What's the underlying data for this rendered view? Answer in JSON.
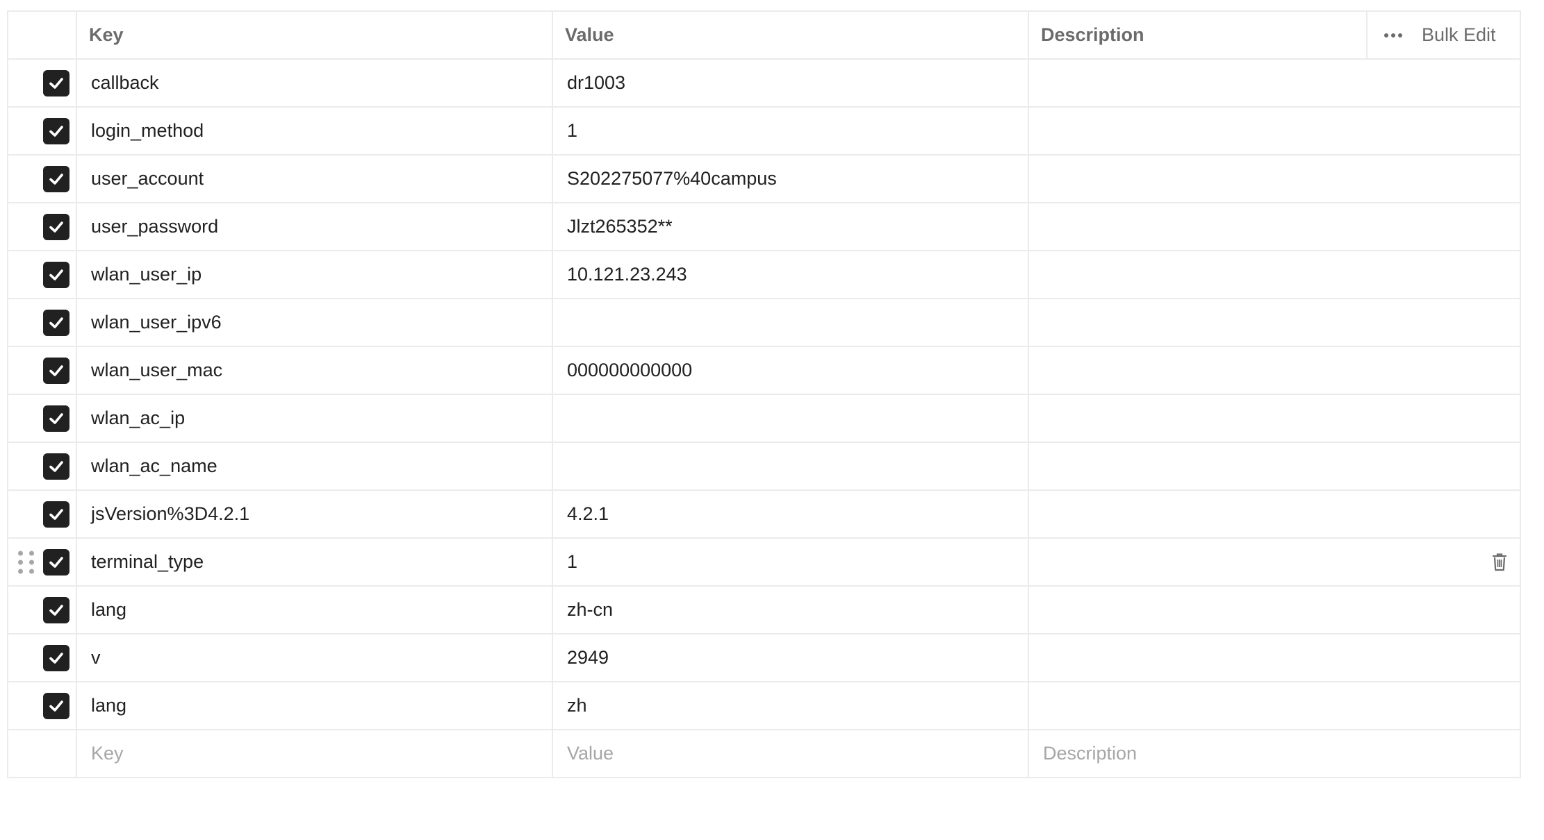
{
  "header": {
    "key": "Key",
    "value": "Value",
    "description": "Description",
    "more_icon": "ellipsis-icon",
    "bulk_edit": "Bulk Edit"
  },
  "rows": [
    {
      "key": "callback",
      "value": "dr1003",
      "description": "",
      "checked": true
    },
    {
      "key": "login_method",
      "value": "1",
      "description": "",
      "checked": true
    },
    {
      "key": "user_account",
      "value": "S202275077%40campus",
      "description": "",
      "checked": true
    },
    {
      "key": "user_password",
      "value": "Jlzt265352**",
      "description": "",
      "checked": true
    },
    {
      "key": "wlan_user_ip",
      "value": "10.121.23.243",
      "description": "",
      "checked": true
    },
    {
      "key": "wlan_user_ipv6",
      "value": "",
      "description": "",
      "checked": true
    },
    {
      "key": "wlan_user_mac",
      "value": "000000000000",
      "description": "",
      "checked": true
    },
    {
      "key": "wlan_ac_ip",
      "value": "",
      "description": "",
      "checked": true
    },
    {
      "key": "wlan_ac_name",
      "value": "",
      "description": "",
      "checked": true
    },
    {
      "key": "jsVersion%3D4.2.1",
      "value": "4.2.1",
      "description": "",
      "checked": true
    },
    {
      "key": "terminal_type",
      "value": "1",
      "description": "",
      "checked": true
    },
    {
      "key": "lang",
      "value": "zh-cn",
      "description": "",
      "checked": true
    },
    {
      "key": "v",
      "value": "2949",
      "description": "",
      "checked": true
    },
    {
      "key": "lang",
      "value": "zh",
      "description": "",
      "checked": true
    }
  ],
  "new_row": {
    "key_placeholder": "Key",
    "value_placeholder": "Value",
    "description_placeholder": "Description"
  },
  "icons": {
    "checkbox": "checkmark-icon",
    "drag": "drag-handle-icon",
    "delete": "trash-icon"
  },
  "colors": {
    "checkbox_fill": "#212121",
    "border": "#ebebeb",
    "header_text": "#6b6b6b",
    "placeholder_text": "#a6a6a6"
  }
}
